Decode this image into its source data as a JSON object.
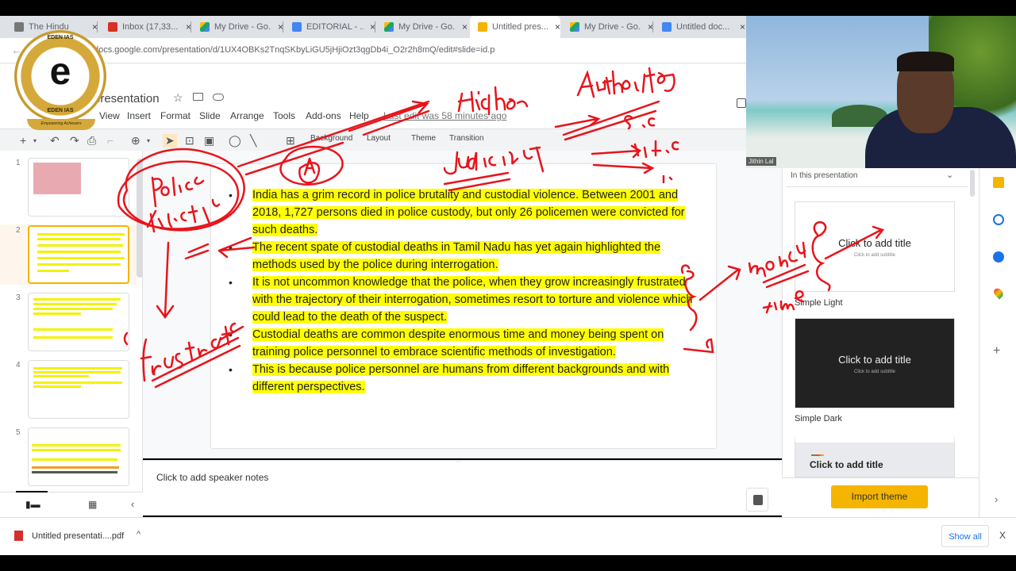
{
  "browser": {
    "tabs": [
      {
        "label": "The Hindu",
        "icon": "the-hindu-icon",
        "color": "#555555"
      },
      {
        "label": "Inbox (17,33...",
        "icon": "gmail-icon",
        "color": "#d93025"
      },
      {
        "label": "My Drive - Go...",
        "icon": "google-drive-icon",
        "color": "#1fa463"
      },
      {
        "label": "EDITORIAL - ...",
        "icon": "google-docs-icon",
        "color": "#4285f4"
      },
      {
        "label": "My Drive - Go...",
        "icon": "google-drive-icon",
        "color": "#1fa463"
      },
      {
        "label": "Untitled pres...",
        "icon": "google-slides-icon",
        "color": "#f4b400",
        "active": true
      },
      {
        "label": "My Drive - Go...",
        "icon": "google-drive-icon",
        "color": "#1fa463"
      },
      {
        "label": "Untitled doc...",
        "icon": "google-docs-icon",
        "color": "#4285f4"
      }
    ],
    "close_glyph": "×",
    "url": "docs.google.com/presentation/d/1UX4OBKs2TnqSKbyLiGU5jHjiOzt3qgDb4i_O2r2h8mQ/edit#slide=id.p"
  },
  "app": {
    "title": "presentation",
    "menus": [
      "View",
      "Insert",
      "Format",
      "Slide",
      "Arrange",
      "Tools",
      "Add-ons",
      "Help"
    ],
    "last_edit": "Last edit was 58 minutes ago",
    "toolbar": {
      "background": "Background",
      "layout": "Layout",
      "theme": "Theme",
      "transition": "Transition"
    }
  },
  "logo": {
    "letter": "e",
    "ring_text": "EDEN IAS",
    "tagline": "Empowering Achievers"
  },
  "filmstrip": {
    "slides": [
      "1",
      "2",
      "3",
      "4",
      "5"
    ],
    "selected": "2"
  },
  "slide": {
    "bullets": [
      "India has a grim record in police brutality and custodial violence. Between 2001 and 2018, 1,727 persons died in police custody, but only 26 policemen were convicted for such deaths.",
      "The recent spate of custodial deaths in Tamil Nadu has yet again highlighted the methods used by the police during interrogation.",
      " It is not uncommon knowledge that the police, when they grow increasingly frustrated with the trajectory of their interrogation, sometimes resort to torture and violence which could lead to the death of the suspect.",
      "Custodial deaths are common despite enormous time and money being spent on training police personnel to embrace scientific methods of investigation.",
      " This is because police personnel are humans from different backgrounds and with different perspectives."
    ],
    "bullet_glyph": "•",
    "highlight_color": "#ffff00"
  },
  "annotations": [
    "Higher",
    "Authority",
    "Judiciary",
    "S.C",
    "H.C",
    "Police",
    "Frustrate",
    "money",
    "time",
    "A"
  ],
  "notes": {
    "placeholder": "Click to add speaker notes"
  },
  "themes": {
    "header": "In this presentation",
    "cards": [
      {
        "name": "Simple Light",
        "title": "Click to add title",
        "subtitle": "Click to add subtitle"
      },
      {
        "name": "Simple Dark",
        "title": "Click to add title",
        "subtitle": "Click to add subtitle"
      },
      {
        "name": "",
        "title": "Click to add title",
        "subtitle": ""
      }
    ],
    "import_label": "Import theme",
    "import_color": "#f4b400"
  },
  "webcam": {
    "name": "Jithin Lal"
  },
  "downloads": {
    "file": "Untitled presentati....pdf",
    "show_all": "Show all",
    "close": "X"
  }
}
